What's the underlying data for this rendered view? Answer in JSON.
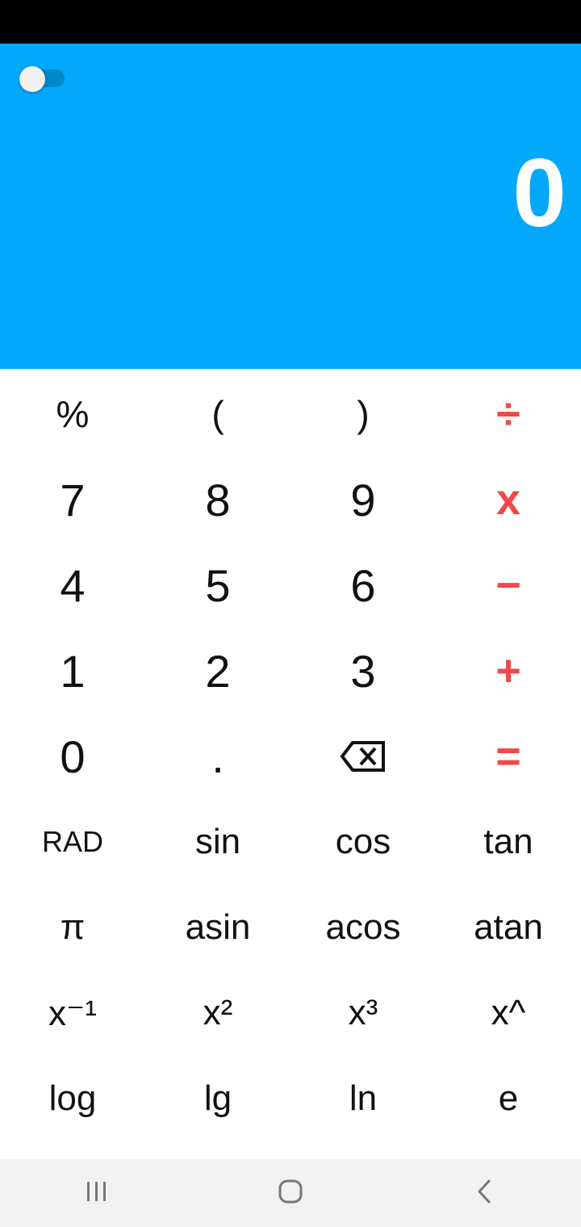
{
  "display": {
    "result": "0"
  },
  "keypad": {
    "row1": [
      "%",
      "(",
      ")",
      "÷"
    ],
    "row2": [
      "7",
      "8",
      "9",
      "x"
    ],
    "row3": [
      "4",
      "5",
      "6",
      "−"
    ],
    "row4": [
      "1",
      "2",
      "3",
      "+"
    ],
    "row5": [
      "0",
      ".",
      "backspace-icon",
      "="
    ],
    "row6": [
      "RAD",
      "sin",
      "cos",
      "tan"
    ],
    "row7": [
      "π",
      "asin",
      "acos",
      "atan"
    ],
    "row8": [
      "x⁻¹",
      "x²",
      "x³",
      "x^"
    ],
    "row9": [
      "log",
      "lg",
      "ln",
      "e"
    ]
  },
  "colors": {
    "display_bg": "#03a8fb",
    "operator": "#f24848",
    "toggle_track": "#0288c9"
  },
  "navigation": {
    "icons": [
      "recent-apps-icon",
      "home-icon",
      "back-icon"
    ]
  }
}
